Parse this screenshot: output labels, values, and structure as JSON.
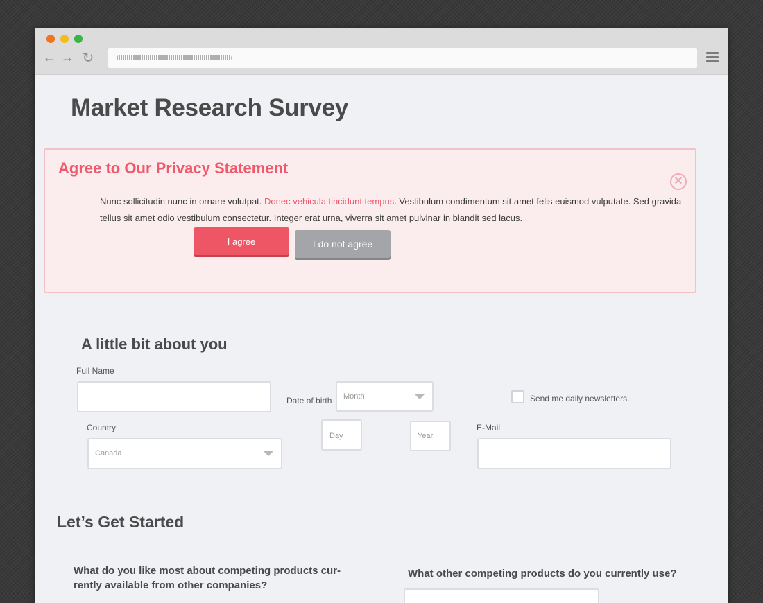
{
  "browser": {
    "nav": {
      "back_icon": "←",
      "forward_icon": "→",
      "reload_icon": "↻"
    }
  },
  "page": {
    "title": "Market Research Survey"
  },
  "alert": {
    "title": "Agree to Our Privacy Statement",
    "close_icon": "✕",
    "text_before": "Nunc sollicitudin nunc in ornare volutpat. ",
    "link_text": "Donec vehicula tincidunt tempus",
    "text_after": ". Vestibulum condimentum sit amet felis euismod vulputate. Sed gravida tellus sit amet odio vestibulum consectetur. Integer erat urna, viverra sit amet pulvinar in blandit sed lacus.",
    "agree_label": "I agree",
    "disagree_label": "I do not agree",
    "colors": {
      "accent": "#ee5a6c",
      "agree_bg": "#ee5565",
      "disagree_bg": "#a3a5a8"
    }
  },
  "about": {
    "heading": "A little bit about you",
    "full_name_label": "Full Name",
    "full_name_value": "",
    "dob_label": "Date of birth",
    "month_value": "Month",
    "day_value": "Day",
    "year_value": "Year",
    "newsletter_label": "Send me daily newsletters.",
    "newsletter_checked": false,
    "country_label": "Country",
    "country_value": "Canada",
    "email_label": "E-Mail",
    "email_value": ""
  },
  "started": {
    "heading": "Let’s Get Started",
    "question1": "What do you like most about competing products cur-rently available from other companies?",
    "question2": "What other competing products do you currently use?"
  }
}
